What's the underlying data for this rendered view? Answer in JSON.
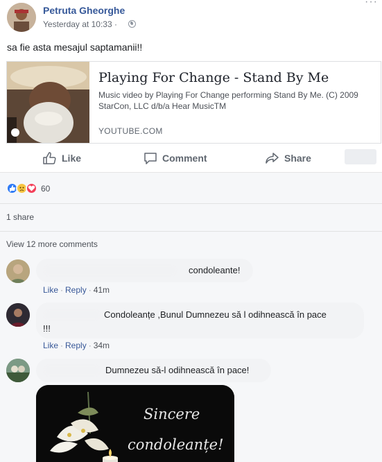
{
  "post": {
    "author": "Petruta Gheorghe",
    "timestamp": "Yesterday at 10:33 ·",
    "options_label": "···",
    "text": "sa fie asta mesajul saptamanii!!"
  },
  "link_preview": {
    "title": "Playing For Change - Stand By Me",
    "description": "Music video by Playing For Change performing Stand By Me. (C) 2009 StarCon, LLC d/b/a Hear MusicTM",
    "domain": "YOUTUBE.COM"
  },
  "actions": {
    "like": "Like",
    "comment": "Comment",
    "share": "Share"
  },
  "feedback": {
    "reaction_count": "60",
    "reactions": [
      "like",
      "sad",
      "love"
    ],
    "shares": "1 share",
    "view_more": "View 12 more comments"
  },
  "comments": [
    {
      "text": "condoleante!",
      "like": "Like",
      "reply": "Reply",
      "time": "41m"
    },
    {
      "text": "Condoleanțe ,Bunul Dumnezeu să l odihnească în pace",
      "text_line2": "!!!",
      "like": "Like",
      "reply": "Reply",
      "time": "34m"
    },
    {
      "text": "Dumnezeu să-l odihnească în pace!",
      "image_line1": "Sincere",
      "image_line2": "condoleanțe!"
    }
  ],
  "colors": {
    "name_blue": "#365899",
    "link_blue": "#385898",
    "like_reaction": "#2f7bf6",
    "sad_reaction": "#f7c542",
    "love_reaction": "#f33e58"
  }
}
